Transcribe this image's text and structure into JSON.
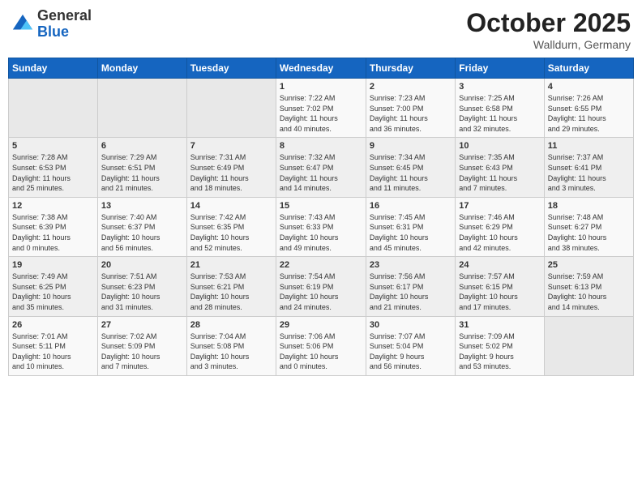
{
  "header": {
    "logo_general": "General",
    "logo_blue": "Blue",
    "month": "October 2025",
    "location": "Walldurn, Germany"
  },
  "weekdays": [
    "Sunday",
    "Monday",
    "Tuesday",
    "Wednesday",
    "Thursday",
    "Friday",
    "Saturday"
  ],
  "weeks": [
    [
      {
        "day": "",
        "content": ""
      },
      {
        "day": "",
        "content": ""
      },
      {
        "day": "",
        "content": ""
      },
      {
        "day": "1",
        "content": "Sunrise: 7:22 AM\nSunset: 7:02 PM\nDaylight: 11 hours\nand 40 minutes."
      },
      {
        "day": "2",
        "content": "Sunrise: 7:23 AM\nSunset: 7:00 PM\nDaylight: 11 hours\nand 36 minutes."
      },
      {
        "day": "3",
        "content": "Sunrise: 7:25 AM\nSunset: 6:58 PM\nDaylight: 11 hours\nand 32 minutes."
      },
      {
        "day": "4",
        "content": "Sunrise: 7:26 AM\nSunset: 6:55 PM\nDaylight: 11 hours\nand 29 minutes."
      }
    ],
    [
      {
        "day": "5",
        "content": "Sunrise: 7:28 AM\nSunset: 6:53 PM\nDaylight: 11 hours\nand 25 minutes."
      },
      {
        "day": "6",
        "content": "Sunrise: 7:29 AM\nSunset: 6:51 PM\nDaylight: 11 hours\nand 21 minutes."
      },
      {
        "day": "7",
        "content": "Sunrise: 7:31 AM\nSunset: 6:49 PM\nDaylight: 11 hours\nand 18 minutes."
      },
      {
        "day": "8",
        "content": "Sunrise: 7:32 AM\nSunset: 6:47 PM\nDaylight: 11 hours\nand 14 minutes."
      },
      {
        "day": "9",
        "content": "Sunrise: 7:34 AM\nSunset: 6:45 PM\nDaylight: 11 hours\nand 11 minutes."
      },
      {
        "day": "10",
        "content": "Sunrise: 7:35 AM\nSunset: 6:43 PM\nDaylight: 11 hours\nand 7 minutes."
      },
      {
        "day": "11",
        "content": "Sunrise: 7:37 AM\nSunset: 6:41 PM\nDaylight: 11 hours\nand 3 minutes."
      }
    ],
    [
      {
        "day": "12",
        "content": "Sunrise: 7:38 AM\nSunset: 6:39 PM\nDaylight: 11 hours\nand 0 minutes."
      },
      {
        "day": "13",
        "content": "Sunrise: 7:40 AM\nSunset: 6:37 PM\nDaylight: 10 hours\nand 56 minutes."
      },
      {
        "day": "14",
        "content": "Sunrise: 7:42 AM\nSunset: 6:35 PM\nDaylight: 10 hours\nand 52 minutes."
      },
      {
        "day": "15",
        "content": "Sunrise: 7:43 AM\nSunset: 6:33 PM\nDaylight: 10 hours\nand 49 minutes."
      },
      {
        "day": "16",
        "content": "Sunrise: 7:45 AM\nSunset: 6:31 PM\nDaylight: 10 hours\nand 45 minutes."
      },
      {
        "day": "17",
        "content": "Sunrise: 7:46 AM\nSunset: 6:29 PM\nDaylight: 10 hours\nand 42 minutes."
      },
      {
        "day": "18",
        "content": "Sunrise: 7:48 AM\nSunset: 6:27 PM\nDaylight: 10 hours\nand 38 minutes."
      }
    ],
    [
      {
        "day": "19",
        "content": "Sunrise: 7:49 AM\nSunset: 6:25 PM\nDaylight: 10 hours\nand 35 minutes."
      },
      {
        "day": "20",
        "content": "Sunrise: 7:51 AM\nSunset: 6:23 PM\nDaylight: 10 hours\nand 31 minutes."
      },
      {
        "day": "21",
        "content": "Sunrise: 7:53 AM\nSunset: 6:21 PM\nDaylight: 10 hours\nand 28 minutes."
      },
      {
        "day": "22",
        "content": "Sunrise: 7:54 AM\nSunset: 6:19 PM\nDaylight: 10 hours\nand 24 minutes."
      },
      {
        "day": "23",
        "content": "Sunrise: 7:56 AM\nSunset: 6:17 PM\nDaylight: 10 hours\nand 21 minutes."
      },
      {
        "day": "24",
        "content": "Sunrise: 7:57 AM\nSunset: 6:15 PM\nDaylight: 10 hours\nand 17 minutes."
      },
      {
        "day": "25",
        "content": "Sunrise: 7:59 AM\nSunset: 6:13 PM\nDaylight: 10 hours\nand 14 minutes."
      }
    ],
    [
      {
        "day": "26",
        "content": "Sunrise: 7:01 AM\nSunset: 5:11 PM\nDaylight: 10 hours\nand 10 minutes."
      },
      {
        "day": "27",
        "content": "Sunrise: 7:02 AM\nSunset: 5:09 PM\nDaylight: 10 hours\nand 7 minutes."
      },
      {
        "day": "28",
        "content": "Sunrise: 7:04 AM\nSunset: 5:08 PM\nDaylight: 10 hours\nand 3 minutes."
      },
      {
        "day": "29",
        "content": "Sunrise: 7:06 AM\nSunset: 5:06 PM\nDaylight: 10 hours\nand 0 minutes."
      },
      {
        "day": "30",
        "content": "Sunrise: 7:07 AM\nSunset: 5:04 PM\nDaylight: 9 hours\nand 56 minutes."
      },
      {
        "day": "31",
        "content": "Sunrise: 7:09 AM\nSunset: 5:02 PM\nDaylight: 9 hours\nand 53 minutes."
      },
      {
        "day": "",
        "content": ""
      }
    ]
  ]
}
